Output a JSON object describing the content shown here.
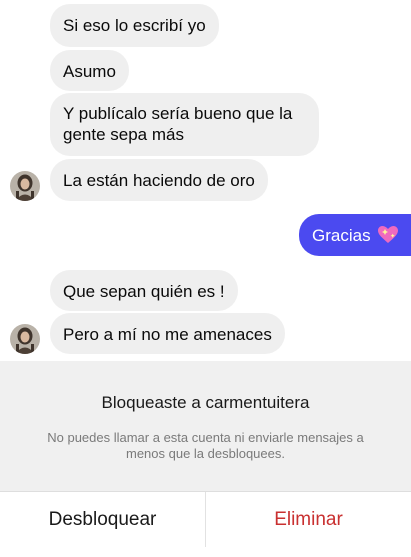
{
  "messages": [
    {
      "text": "Si eso lo escribí yo"
    },
    {
      "text": "Asumo"
    },
    {
      "text": "Y publícalo sería bueno que la gente sepa más"
    },
    {
      "text": "La están haciendo de oro"
    },
    {
      "text": "Gracias"
    },
    {
      "text": "Que sepan quién es !"
    },
    {
      "text": "Pero a mí no me amenaces"
    }
  ],
  "block_panel": {
    "title": "Bloqueaste a carmentuitera",
    "description": "No puedes llamar a esta cuenta ni enviarle mensajes a menos que la desbloquees.",
    "unblock_label": "Desbloquear",
    "delete_label": "Eliminar"
  },
  "colors": {
    "outgoing_bubble": "#4b4af0",
    "incoming_bubble": "#efefef",
    "delete_text": "#c93030"
  },
  "icons": {
    "emoji": "sparkling-heart-icon"
  }
}
